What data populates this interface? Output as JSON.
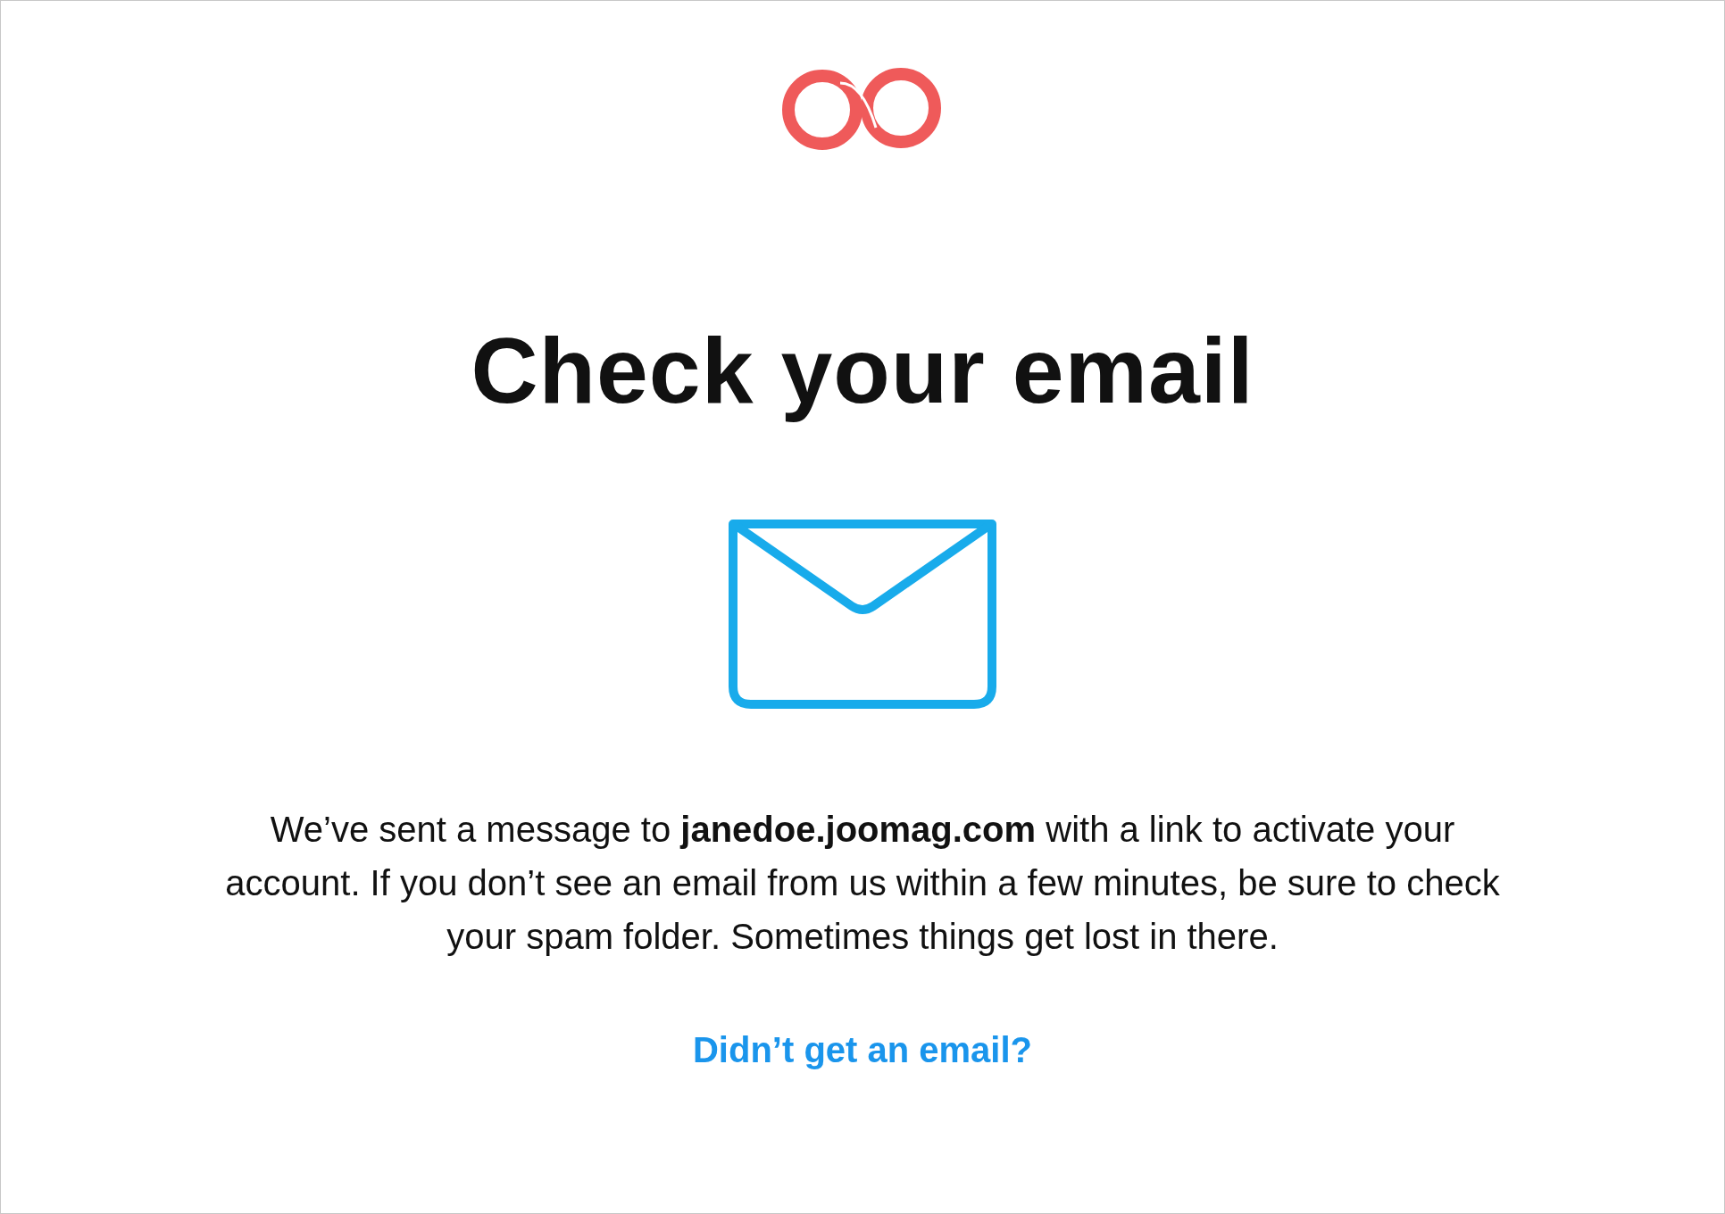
{
  "heading": "Check your email",
  "message": "We’ve sent a message to **janedoe.joomag.com** with a link to activate your account. If you don’t see an email from us within a few minutes, be sure to check your spam folder. Sometimes things get lost in there.",
  "resend_link": "Didn’t get an email?"
}
